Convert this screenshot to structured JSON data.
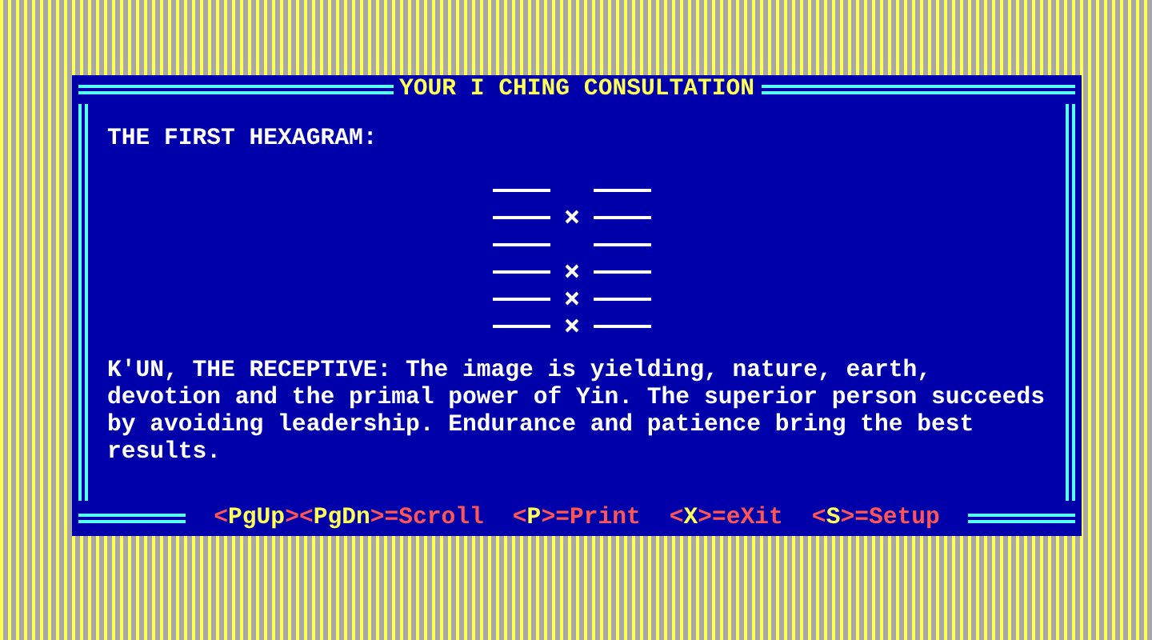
{
  "window": {
    "title": "YOUR I CHING CONSULTATION"
  },
  "heading": "THE FIRST HEXAGRAM:",
  "hexagram": {
    "lines": [
      {
        "changing": false
      },
      {
        "changing": true
      },
      {
        "changing": false
      },
      {
        "changing": true
      },
      {
        "changing": true
      },
      {
        "changing": true
      }
    ]
  },
  "reading": [
    "K'UN, THE RECEPTIVE: The image is yielding, nature, earth,",
    "devotion and the primal power of Yin. The superior person succeeds",
    "by avoiding leadership. Endurance and patience bring the best",
    "results."
  ],
  "footer": {
    "commands": [
      {
        "parts": [
          {
            "text": "<",
            "highlight": false
          },
          {
            "text": "PgUp",
            "highlight": true
          },
          {
            "text": "><",
            "highlight": false
          },
          {
            "text": "PgDn",
            "highlight": true
          },
          {
            "text": ">=Scroll",
            "highlight": false
          }
        ]
      },
      {
        "parts": [
          {
            "text": "<",
            "highlight": false
          },
          {
            "text": "P",
            "highlight": true
          },
          {
            "text": ">=Print",
            "highlight": false
          }
        ]
      },
      {
        "parts": [
          {
            "text": "<",
            "highlight": false
          },
          {
            "text": "X",
            "highlight": true
          },
          {
            "text": ">=eXit",
            "highlight": false
          }
        ]
      },
      {
        "parts": [
          {
            "text": "<",
            "highlight": false
          },
          {
            "text": "S",
            "highlight": true
          },
          {
            "text": ">=Setup",
            "highlight": false
          }
        ]
      }
    ]
  }
}
